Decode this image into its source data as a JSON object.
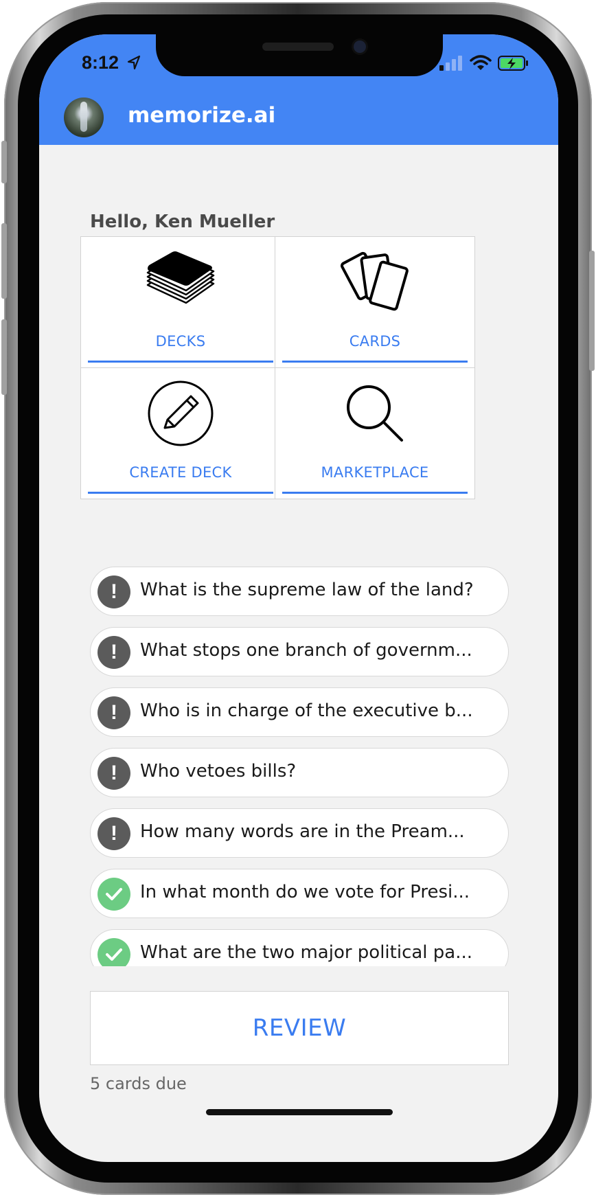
{
  "status_bar": {
    "time": "8:12",
    "icons": [
      "location-icon",
      "cellular-signal-icon",
      "wifi-icon",
      "battery-charging-icon"
    ]
  },
  "header": {
    "avatar": "user-avatar",
    "title": "memorize.ai",
    "background": "#4385f4"
  },
  "greeting": "Hello, Ken Mueller",
  "tiles": [
    {
      "label": "DECKS",
      "icon": "deck-stack-icon"
    },
    {
      "label": "CARDS",
      "icon": "cards-fan-icon"
    },
    {
      "label": "CREATE DECK",
      "icon": "pencil-circle-icon"
    },
    {
      "label": "MARKETPLACE",
      "icon": "magnifier-icon"
    }
  ],
  "questions": [
    {
      "text": "What is the supreme law of the land?",
      "status": "due",
      "icon": "exclamation-icon"
    },
    {
      "text": "What stops one branch of governm...",
      "status": "due",
      "icon": "exclamation-icon"
    },
    {
      "text": "Who is in charge of the executive b...",
      "status": "due",
      "icon": "exclamation-icon"
    },
    {
      "text": "Who vetoes bills?",
      "status": "due",
      "icon": "exclamation-icon"
    },
    {
      "text": "How many words are in the Pream...",
      "status": "due",
      "icon": "exclamation-icon"
    },
    {
      "text": "In what month do we vote for Presi...",
      "status": "done",
      "icon": "checkmark-icon"
    },
    {
      "text": "What are the two major political pa...",
      "status": "done",
      "icon": "checkmark-icon"
    }
  ],
  "review": {
    "label": "REVIEW",
    "due_text": "5 cards due"
  },
  "colors": {
    "accent": "#3a7cf0",
    "due_badge": "#5b5b5b",
    "done_badge": "#6ccc83"
  }
}
